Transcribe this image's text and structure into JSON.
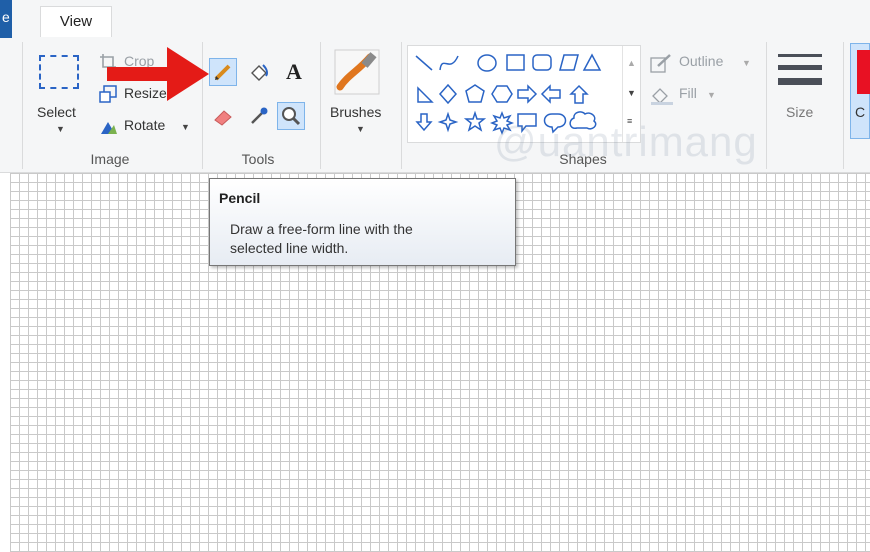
{
  "tabs": {
    "file_glyph": "e",
    "view": "View"
  },
  "image_group": {
    "label": "Image",
    "select_label": "Select",
    "crop_label": "Crop",
    "resize_label": "Resize",
    "rotate_label": "Rotate"
  },
  "tools_group": {
    "label": "Tools",
    "text_tool_glyph": "A"
  },
  "brushes": {
    "label": "Brushes"
  },
  "shapes_group": {
    "label": "Shapes",
    "outline_label": "Outline",
    "fill_label": "Fill"
  },
  "size": {
    "label": "Size"
  },
  "color": {
    "label_fragment": "C",
    "active_color": "#e81123"
  },
  "tooltip": {
    "title": "Pencil",
    "line1": "Draw a free-form line with the",
    "line2": "selected line width."
  },
  "watermark": "@uantrimang",
  "colors": {
    "accent_blue": "#2a64c5",
    "arrow_red": "#e41b17",
    "selected_bg": "#cfe4fb"
  }
}
